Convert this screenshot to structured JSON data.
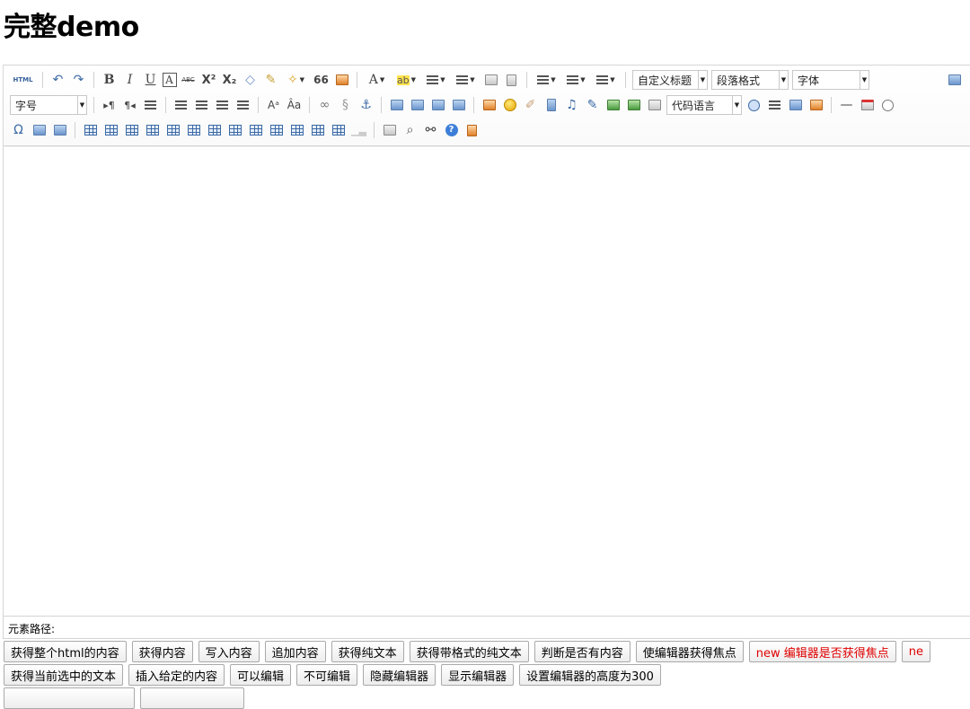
{
  "page": {
    "title": "完整demo"
  },
  "toolbar": {
    "html_label": "HTML",
    "bold": "B",
    "italic": "I",
    "underline": "U",
    "fontborder": "A",
    "strike": "ABC",
    "superscript": "X²",
    "subscript": "X₂",
    "blockquote": "66",
    "forecolor": "A",
    "backcolor": "ab",
    "combos": {
      "customstyle": "自定义标题",
      "paragraph": "段落格式",
      "fontfamily": "字体",
      "fontsize": "字号",
      "codelanguage": "代码语言"
    },
    "charmap": "Ω",
    "help": "?"
  },
  "editor": {
    "element_path_label": "元素路径:"
  },
  "buttons": {
    "row1": [
      "获得整个html的内容",
      "获得内容",
      "写入内容",
      "追加内容",
      "获得纯文本",
      "获得带格式的纯文本",
      "判断是否有内容",
      "使编辑器获得焦点",
      "new 编辑器是否获得焦点",
      "ne"
    ],
    "row2": [
      "获得当前选中的文本",
      "插入给定的内容",
      "可以编辑",
      "不可编辑",
      "隐藏编辑器",
      "显示编辑器",
      "设置编辑器的高度为300"
    ]
  },
  "colors": {
    "accent_red": "#e00000",
    "icon_blue": "#3c6aa5"
  }
}
